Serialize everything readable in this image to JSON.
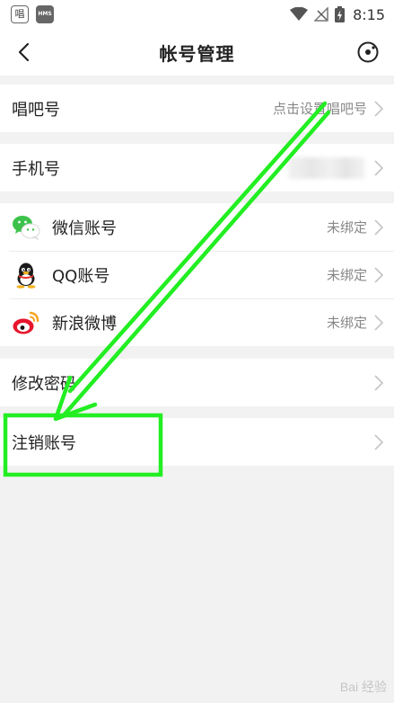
{
  "status_bar": {
    "app1_glyph": "唱",
    "app2_label": "HMS",
    "time": "8:15"
  },
  "header": {
    "title": "帐号管理"
  },
  "accounts": {
    "changba_id": {
      "label": "唱吧号",
      "value": "点击设置唱吧号"
    },
    "phone": {
      "label": "手机号"
    },
    "bindings": [
      {
        "label": "微信账号",
        "status": "未绑定",
        "icon": "wechat-icon"
      },
      {
        "label": "QQ账号",
        "status": "未绑定",
        "icon": "qq-icon"
      },
      {
        "label": "新浪微博",
        "status": "未绑定",
        "icon": "weibo-icon"
      }
    ],
    "change_password": {
      "label": "修改密码"
    },
    "deactivate": {
      "label": "注销账号"
    }
  },
  "annotation": {
    "color": "#22ee22"
  },
  "watermark": {
    "text": "Bai 经验"
  }
}
